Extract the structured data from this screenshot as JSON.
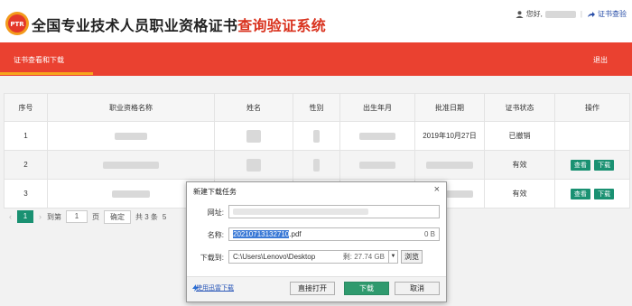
{
  "header": {
    "logo_text": "PTR",
    "title_main": "全国专业技术人员职业资格证书",
    "title_accent": "查询验证系统",
    "greeting": "您好,",
    "cert_link": "证书查验"
  },
  "nav": {
    "tab": "证书查看和下载",
    "exit": "退出"
  },
  "table": {
    "headers": [
      "序号",
      "职业资格名称",
      "姓名",
      "性别",
      "出生年月",
      "批准日期",
      "证书状态",
      "操作"
    ],
    "rows": [
      {
        "index": "1",
        "approval_date": "2019年10月27日",
        "status": "已撤销",
        "actions": []
      },
      {
        "index": "2",
        "approval_date": "",
        "status": "有效",
        "actions": [
          "查看",
          "下载"
        ]
      },
      {
        "index": "3",
        "approval_date": "",
        "status": "有效",
        "actions": [
          "查看",
          "下载"
        ]
      }
    ],
    "view_label": "查看",
    "download_label": "下载"
  },
  "pager": {
    "current": "1",
    "goto": "到第",
    "input": "1",
    "page_unit": "页",
    "ok": "确定",
    "total": "共 3 条",
    "size_partial": "5"
  },
  "dialog": {
    "title": "新建下载任务",
    "url_label": "网址:",
    "name_label": "名称:",
    "name_selected": "20210713132710",
    "name_ext": ".pdf",
    "name_size": "0 B",
    "saveto_label": "下载到:",
    "path": "C:\\Users\\Lenovo\\Desktop",
    "free_space": "剩: 27.74 GB",
    "browse": "浏览",
    "thunder_link": "使用迅雷下载",
    "open_btn": "直接打开",
    "download_btn": "下载",
    "cancel_btn": "取消"
  },
  "colors": {
    "brand_red": "#ea4130",
    "accent_orange": "#f7a61c",
    "action_green": "#1a9172"
  }
}
